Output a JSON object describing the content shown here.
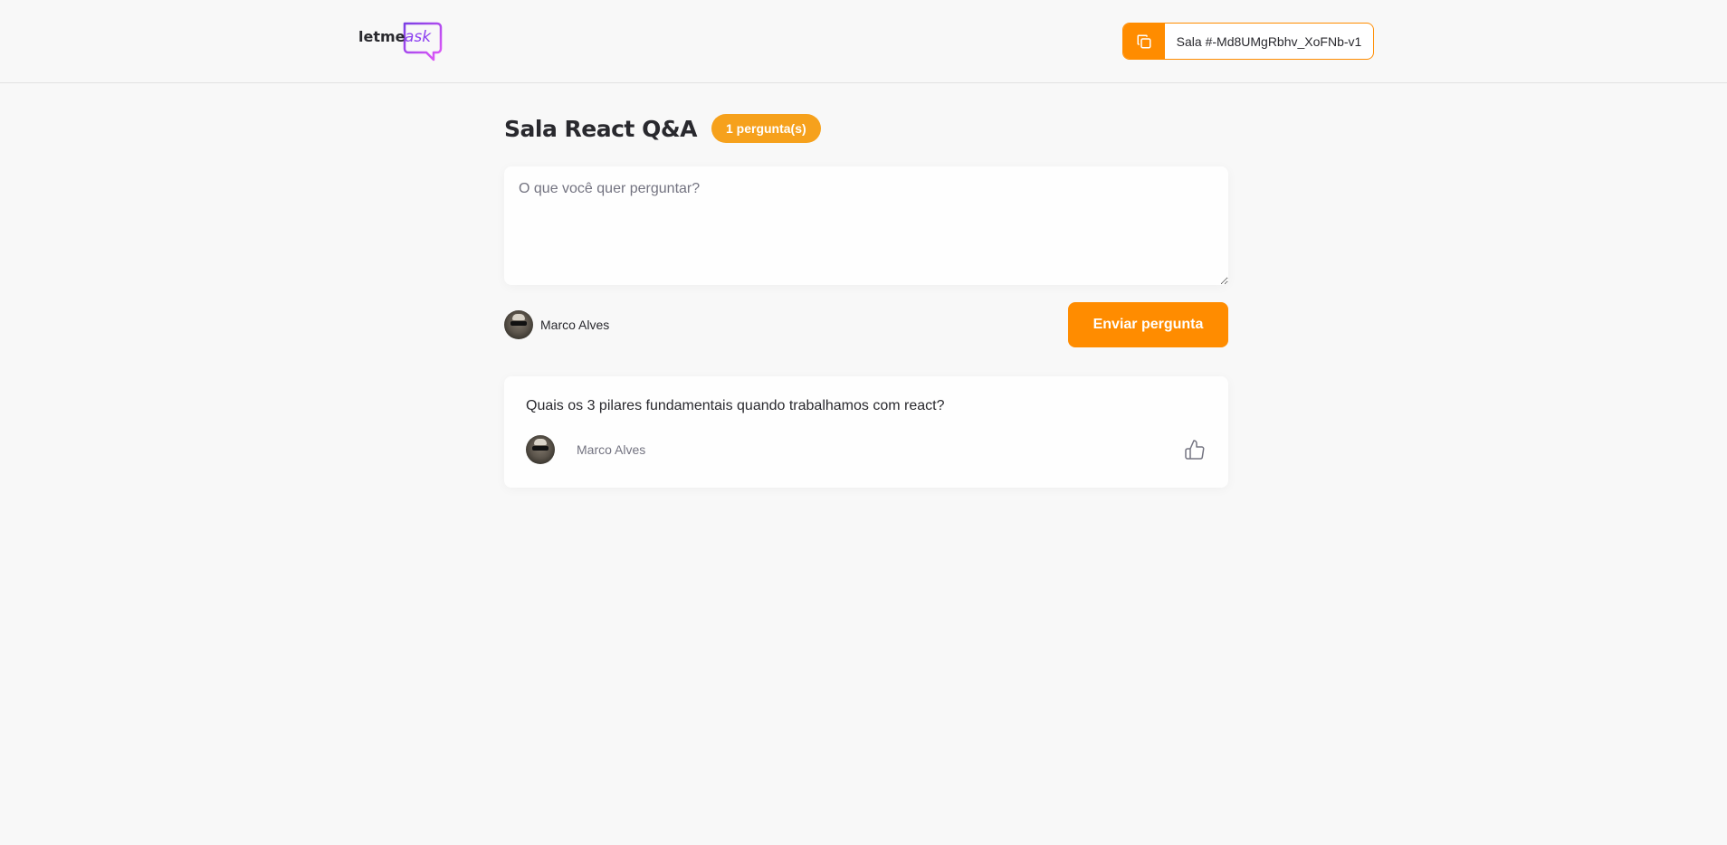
{
  "header": {
    "logo": {
      "text_left": "letme",
      "text_right": "ask",
      "icon": "speech-bubble-icon"
    },
    "room_code": {
      "label": "Sala #-Md8UMgRbhv_XoFNb-v1",
      "icon": "copy-icon"
    }
  },
  "room": {
    "title": "Sala React Q&A",
    "question_count_badge": "1 pergunta(s)"
  },
  "form": {
    "placeholder": "O que você quer perguntar?",
    "value": "",
    "user": {
      "name": "Marco Alves"
    },
    "submit_label": "Enviar pergunta"
  },
  "questions": [
    {
      "content": "Quais os 3 pilares fundamentais quando trabalhamos com react?",
      "author": "Marco Alves",
      "like_icon": "thumbs-up-icon"
    }
  ],
  "colors": {
    "accent": "#ff8c00",
    "badge": "#f6a11c",
    "logo_gradient_start": "#7b3fe4",
    "logo_gradient_end": "#e559f9",
    "background": "#f8f8f8",
    "text": "#29292e",
    "muted": "#737380"
  }
}
